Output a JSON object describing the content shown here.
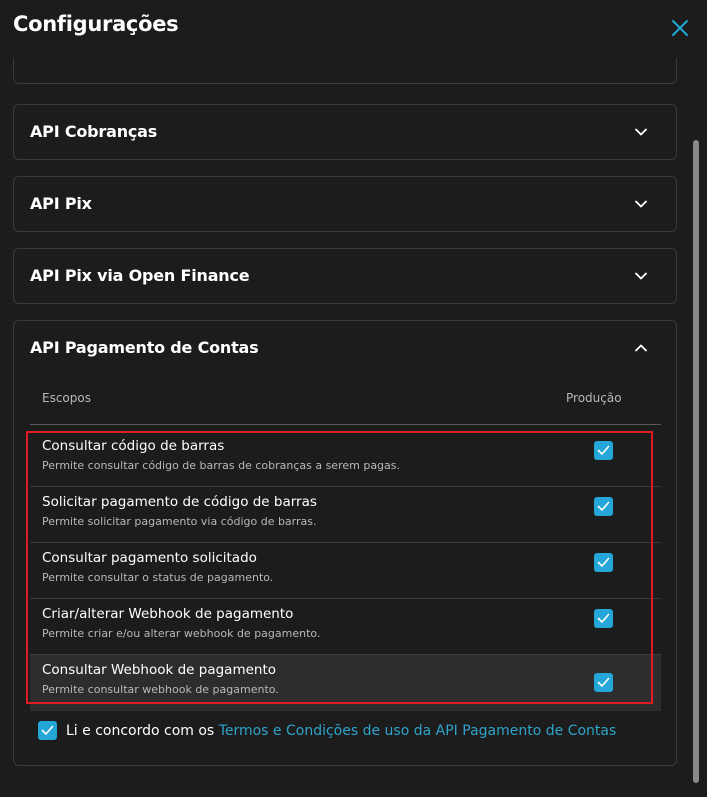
{
  "page": {
    "title": "Configurações"
  },
  "icons": {
    "close": "close-icon",
    "chevron_down": "chevron-down-icon",
    "chevron_up": "chevron-up-icon",
    "check": "check-icon"
  },
  "colors": {
    "accent": "#25a6d9",
    "link": "#2ea3c9",
    "highlight_border": "#e01b24",
    "background": "#1c1c1d"
  },
  "sections": [
    {
      "title": "API Cobranças",
      "expanded": false
    },
    {
      "title": "API Pix",
      "expanded": false
    },
    {
      "title": "API Pix via Open Finance",
      "expanded": false
    },
    {
      "title": "API Pagamento de Contas",
      "expanded": true
    }
  ],
  "scopes_table": {
    "col_scopes": "Escopos",
    "col_production": "Produção",
    "rows": [
      {
        "title": "Consultar código de barras",
        "description": "Permite consultar código de barras de cobranças a serem pagas.",
        "checked": true
      },
      {
        "title": "Solicitar pagamento de código de barras",
        "description": "Permite solicitar pagamento via código de barras.",
        "checked": true
      },
      {
        "title": "Consultar pagamento solicitado",
        "description": "Permite consultar o status de pagamento.",
        "checked": true
      },
      {
        "title": "Criar/alterar Webhook de pagamento",
        "description": "Permite criar e/ou alterar webhook de pagamento.",
        "checked": true
      },
      {
        "title": "Consultar Webhook de pagamento",
        "description": "Permite consultar webhook de pagamento.",
        "checked": true
      }
    ]
  },
  "agreement": {
    "checked": true,
    "text": "Li e concordo com os",
    "link": "Termos e Condições de uso da API Pagamento de Contas"
  }
}
